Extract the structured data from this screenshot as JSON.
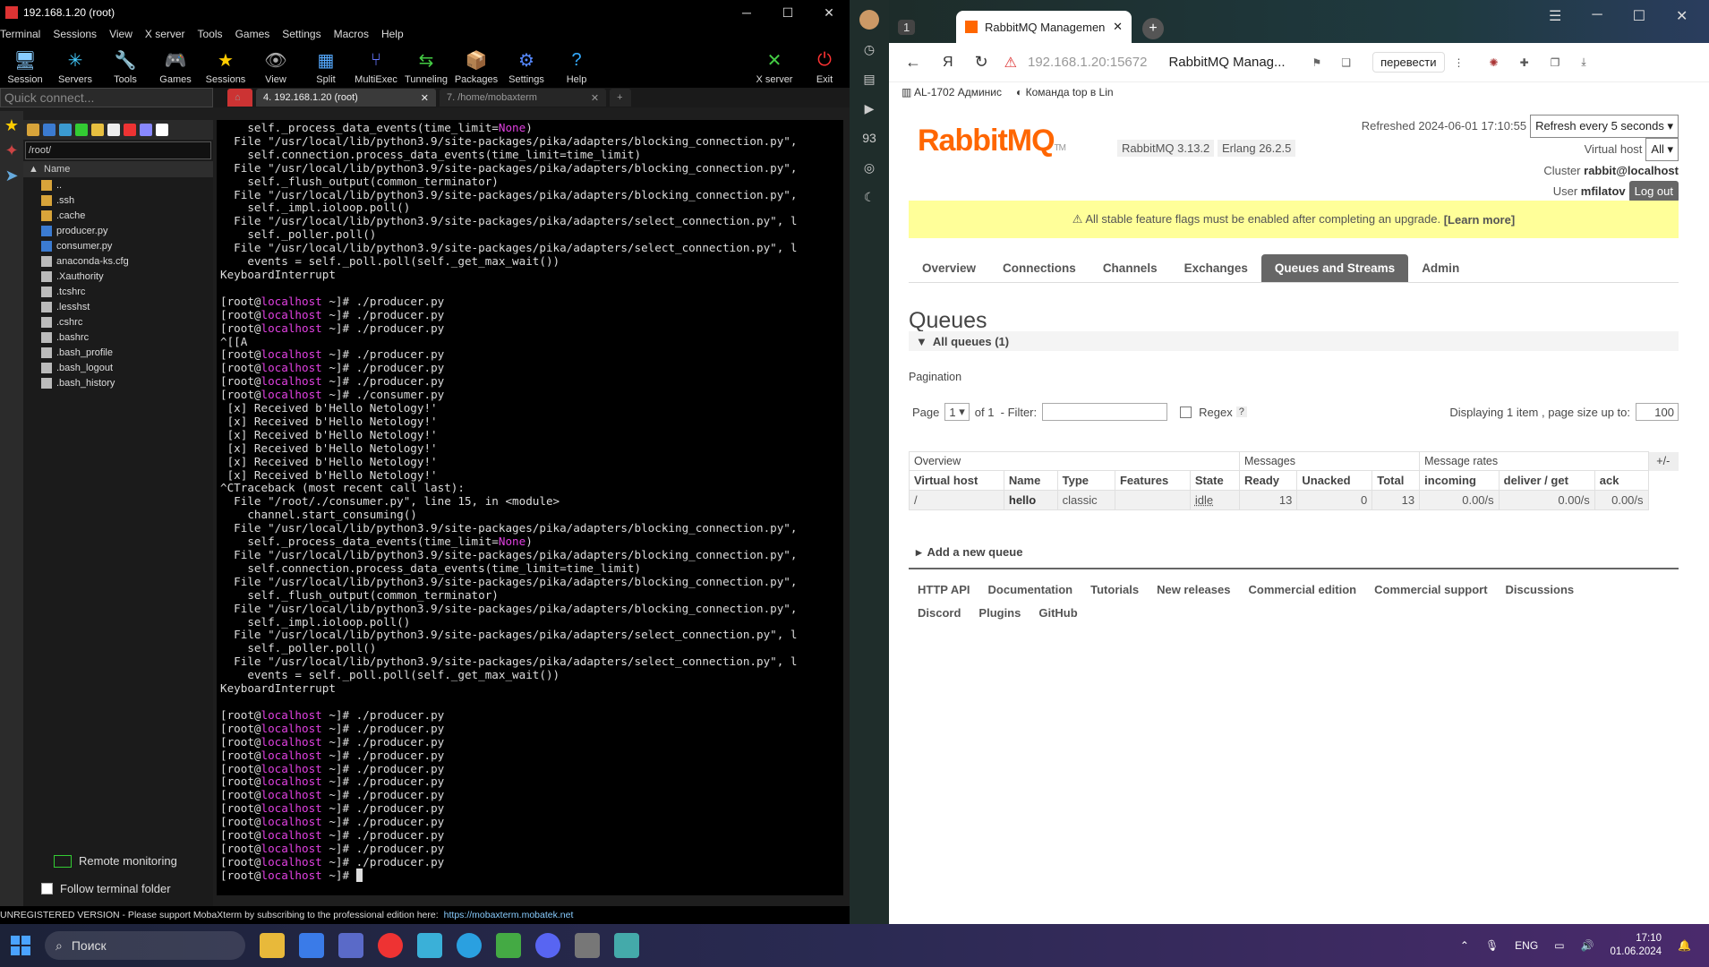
{
  "moba": {
    "title": "192.168.1.20 (root)",
    "menu": [
      "Terminal",
      "Sessions",
      "View",
      "X server",
      "Tools",
      "Games",
      "Settings",
      "Macros",
      "Help"
    ],
    "toolbar": [
      "Session",
      "Servers",
      "Tools",
      "Games",
      "Sessions",
      "View",
      "Split",
      "MultiExec",
      "Tunneling",
      "Packages",
      "Settings",
      "Help"
    ],
    "toolbar_right": [
      "X server",
      "Exit"
    ],
    "quick_connect": "Quick connect...",
    "tabs": [
      "4. 192.168.1.20 (root)",
      "7. /home/mobaxterm"
    ],
    "path": "/root/",
    "col_name": "Name",
    "files": [
      {
        "name": "..",
        "kind": "folder"
      },
      {
        "name": ".ssh",
        "kind": "folder"
      },
      {
        "name": ".cache",
        "kind": "folder"
      },
      {
        "name": "producer.py",
        "kind": "py"
      },
      {
        "name": "consumer.py",
        "kind": "py"
      },
      {
        "name": "anaconda-ks.cfg",
        "kind": "file"
      },
      {
        "name": ".Xauthority",
        "kind": "file"
      },
      {
        "name": ".tcshrc",
        "kind": "file"
      },
      {
        "name": ".lesshst",
        "kind": "file"
      },
      {
        "name": ".cshrc",
        "kind": "file"
      },
      {
        "name": ".bashrc",
        "kind": "file"
      },
      {
        "name": ".bash_profile",
        "kind": "file"
      },
      {
        "name": ".bash_logout",
        "kind": "file"
      },
      {
        "name": ".bash_history",
        "kind": "file"
      }
    ],
    "remote_monitoring": "Remote monitoring",
    "follow_folder": "Follow terminal folder",
    "status_text": "UNREGISTERED VERSION  -  Please support MobaXterm by subscribing to the professional edition here:",
    "status_link": "https://mobaxterm.mobatek.net",
    "terminal_lines": [
      "    self._process_data_events(time_limit=None)",
      "  File \"/usr/local/lib/python3.9/site-packages/pika/adapters/blocking_connection.py\",",
      "    self.connection.process_data_events(time_limit=time_limit)",
      "  File \"/usr/local/lib/python3.9/site-packages/pika/adapters/blocking_connection.py\",",
      "    self._flush_output(common_terminator)",
      "  File \"/usr/local/lib/python3.9/site-packages/pika/adapters/blocking_connection.py\",",
      "    self._impl.ioloop.poll()",
      "  File \"/usr/local/lib/python3.9/site-packages/pika/adapters/select_connection.py\", l",
      "    self._poller.poll()",
      "  File \"/usr/local/lib/python3.9/site-packages/pika/adapters/select_connection.py\", l",
      "    events = self._poll.poll(self._get_max_wait())",
      "KeyboardInterrupt",
      "",
      "[root@localhost ~]# ./producer.py",
      "[root@localhost ~]# ./producer.py",
      "[root@localhost ~]# ./producer.py",
      "^[[A",
      "[root@localhost ~]# ./producer.py",
      "[root@localhost ~]# ./producer.py",
      "[root@localhost ~]# ./producer.py",
      "[root@localhost ~]# ./consumer.py",
      " [x] Received b'Hello Netology!'",
      " [x] Received b'Hello Netology!'",
      " [x] Received b'Hello Netology!'",
      " [x] Received b'Hello Netology!'",
      " [x] Received b'Hello Netology!'",
      " [x] Received b'Hello Netology!'",
      "^CTraceback (most recent call last):",
      "  File \"/root/./consumer.py\", line 15, in <module>",
      "    channel.start_consuming()",
      "  File \"/usr/local/lib/python3.9/site-packages/pika/adapters/blocking_connection.py\",",
      "    self._process_data_events(time_limit=None)",
      "  File \"/usr/local/lib/python3.9/site-packages/pika/adapters/blocking_connection.py\",",
      "    self.connection.process_data_events(time_limit=time_limit)",
      "  File \"/usr/local/lib/python3.9/site-packages/pika/adapters/blocking_connection.py\",",
      "    self._flush_output(common_terminator)",
      "  File \"/usr/local/lib/python3.9/site-packages/pika/adapters/blocking_connection.py\",",
      "    self._impl.ioloop.poll()",
      "  File \"/usr/local/lib/python3.9/site-packages/pika/adapters/select_connection.py\", l",
      "    self._poller.poll()",
      "  File \"/usr/local/lib/python3.9/site-packages/pika/adapters/select_connection.py\", l",
      "    events = self._poll.poll(self._get_max_wait())",
      "KeyboardInterrupt",
      "",
      "[root@localhost ~]# ./producer.py",
      "[root@localhost ~]# ./producer.py",
      "[root@localhost ~]# ./producer.py",
      "[root@localhost ~]# ./producer.py",
      "[root@localhost ~]# ./producer.py",
      "[root@localhost ~]# ./producer.py",
      "[root@localhost ~]# ./producer.py",
      "[root@localhost ~]# ./producer.py",
      "[root@localhost ~]# ./producer.py",
      "[root@localhost ~]# ./producer.py",
      "[root@localhost ~]# ./producer.py",
      "[root@localhost ~]# ./producer.py",
      "[root@localhost ~]# "
    ]
  },
  "browser": {
    "tab_title": "RabbitMQ Managemen",
    "tab_count": "1",
    "url": "192.168.1.20:15672",
    "page_title": "RabbitMQ Manag...",
    "translate": "перевести",
    "bookmarks": [
      "AL-1702 Админис",
      "Команда top в Lin"
    ]
  },
  "rabbit": {
    "logo": "RabbitMQ",
    "tm": "TM",
    "version": "RabbitMQ 3.13.2",
    "erlang": "Erlang 26.2.5",
    "refreshed": "Refreshed 2024-06-01 17:10:55",
    "refresh_select": "Refresh every 5 seconds",
    "vhost_label": "Virtual host",
    "vhost_value": "All",
    "cluster_label": "Cluster",
    "cluster_value": "rabbit@localhost",
    "user_label": "User",
    "user_value": "mfilatov",
    "logout": "Log out",
    "banner": "⚠ All stable feature flags must be enabled after completing an upgrade.",
    "banner_link": "[Learn more]",
    "nav": [
      "Overview",
      "Connections",
      "Channels",
      "Exchanges",
      "Queues and Streams",
      "Admin"
    ],
    "nav_active": "Queues and Streams",
    "queues_title": "Queues",
    "all_queues": "All queues (1)",
    "pagination": "Pagination",
    "page_label": "Page",
    "page_value": "1",
    "of": "of 1",
    "filter_label": "- Filter:",
    "regex": "Regex",
    "help": "?",
    "displaying": "Displaying 1 item , page size up to:",
    "page_size": "100",
    "groups": [
      "Overview",
      "Messages",
      "Message rates"
    ],
    "plusminus": "+/-",
    "headers": [
      "Virtual host",
      "Name",
      "Type",
      "Features",
      "State",
      "Ready",
      "Unacked",
      "Total",
      "incoming",
      "deliver / get",
      "ack"
    ],
    "row": [
      "/",
      "hello",
      "classic",
      "",
      "idle",
      "13",
      "0",
      "13",
      "0.00/s",
      "0.00/s",
      "0.00/s"
    ],
    "add_queue": "Add a new queue",
    "footer": [
      "HTTP API",
      "Documentation",
      "Tutorials",
      "New releases",
      "Commercial edition",
      "Commercial support",
      "Discussions",
      "Discord",
      "Plugins",
      "GitHub"
    ]
  },
  "taskbar": {
    "search": "Поиск",
    "lang": "ENG",
    "time": "17:10",
    "date": "01.06.2024"
  }
}
